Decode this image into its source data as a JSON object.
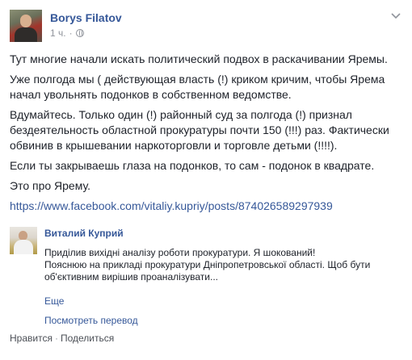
{
  "post": {
    "author": "Borys Filatov",
    "timestamp": "1 ч.",
    "privacy_icon": "globe-icon",
    "menu_icon": "chevron-down-icon",
    "paragraphs": [
      "Тут многие начали искать политический подвох в раскачивании Яремы.",
      "Уже полгода мы ( действующая власть (!) криком кричим, чтобы Ярема начал увольнять подонков в собственном ведомстве.",
      "Вдумайтесь. Только один (!) районный суд за полгода (!) признал бездеятельность областной прокуратуры почти 150 (!!!) раз. Фактически обвинив в крышевании наркоторговли и торговле детьми (!!!!).",
      "Если ты закрываешь глаза на подонков, то сам - подонок в квадрате.",
      "Это про Ярему."
    ],
    "link": "https://www.facebook.com/vitaliy.kupriy/posts/874026589297939"
  },
  "shared": {
    "author": "Виталий Куприй",
    "lines": [
      "Приділив вихідні аналізу роботи прокуратури. Я шокований!",
      "Пояснюю на прикладі прокуратури Дніпропетровської області. Щоб бути",
      "об'єктивним вирішив проаналізувати..."
    ],
    "more_label": "Еще",
    "translate_label": "Посмотреть перевод"
  },
  "footer": {
    "like_label": "Нравится",
    "separator": "·",
    "share_label": "Поделиться"
  },
  "colors": {
    "link": "#365899",
    "text": "#1d2129",
    "meta": "#90949c"
  }
}
